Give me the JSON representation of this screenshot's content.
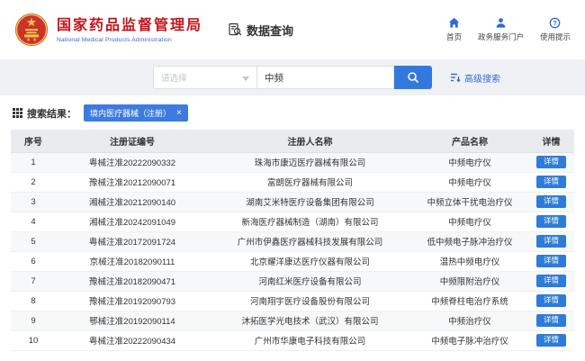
{
  "colors": {
    "brand_red": "#c4151c",
    "accent_blue": "#2f6bd8",
    "button_blue": "#3279dd"
  },
  "header": {
    "agency_cn": "国家药品监督管理局",
    "agency_en": "National Medical Products Administration",
    "app_title": "数据查询",
    "nav": [
      {
        "label": "首页",
        "icon": "home-icon"
      },
      {
        "label": "政务服务门户",
        "icon": "user-icon"
      },
      {
        "label": "使用提示",
        "icon": "help-icon"
      }
    ]
  },
  "search": {
    "select_placeholder": "请选择",
    "query_value": "中频",
    "advanced_label": "高级搜索"
  },
  "results": {
    "label": "搜索结果：",
    "filter_tag": "境内医疗器械（注册）",
    "tag_close": "×"
  },
  "table": {
    "columns": [
      "序号",
      "注册证编号",
      "注册人名称",
      "产品名称",
      "详情"
    ],
    "detail_label": "详情",
    "rows": [
      {
        "no": "1",
        "cert": "粤械注准20222090332",
        "registrant": "珠海市康迈医疗器械有限公司",
        "product": "中频电疗仪"
      },
      {
        "no": "2",
        "cert": "豫械注准20212090071",
        "registrant": "富朗医疗器械有限公司",
        "product": "中频电疗仪"
      },
      {
        "no": "3",
        "cert": "湘械注准20212090140",
        "registrant": "湖南艾米特医疗设备集团有限公司",
        "product": "中频立体干扰电治疗仪"
      },
      {
        "no": "4",
        "cert": "湘械注准20242091049",
        "registrant": "新海医疗器械制造（湖南）有限公司",
        "product": "中频电疗仪"
      },
      {
        "no": "5",
        "cert": "粤械注准20172091724",
        "registrant": "广州市伊鑫医疗器械科技发展有限公司",
        "product": "低中频电子脉冲治疗仪"
      },
      {
        "no": "6",
        "cert": "京械注准20182090111",
        "registrant": "北京耀洋康达医疗仪器有限公司",
        "product": "温热中频电疗仪"
      },
      {
        "no": "7",
        "cert": "豫械注准20182090471",
        "registrant": "河南红米医疗设备有限公司",
        "product": "中频限附治疗仪"
      },
      {
        "no": "8",
        "cert": "豫械注准20192090793",
        "registrant": "河南翔宇医疗设备股份有限公司",
        "product": "中频脊柱电治疗系统"
      },
      {
        "no": "9",
        "cert": "鄂械注准20192090114",
        "registrant": "沐拓医学光电技术（武汉）有限公司",
        "product": "中频治疗仪"
      },
      {
        "no": "10",
        "cert": "粤械注准20222090434",
        "registrant": "广州市华康电子科技有限公司",
        "product": "中频电子脉冲治疗仪"
      }
    ]
  }
}
